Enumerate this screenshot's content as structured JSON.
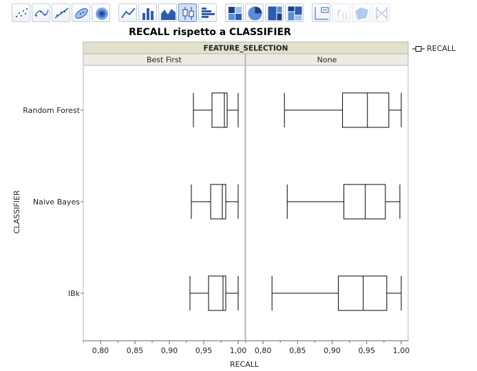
{
  "toolbar": {
    "buttons": [
      {
        "name": "points-icon",
        "state": "normal"
      },
      {
        "name": "smoother-icon",
        "state": "normal"
      },
      {
        "name": "line-of-fit-icon",
        "state": "normal"
      },
      {
        "name": "ellipse-icon",
        "state": "normal"
      },
      {
        "name": "contour-icon",
        "state": "normal"
      },
      {
        "name": "line-chart-icon",
        "state": "normal"
      },
      {
        "name": "bar-chart-icon",
        "state": "normal"
      },
      {
        "name": "area-chart-icon",
        "state": "normal"
      },
      {
        "name": "box-plot-icon",
        "state": "selected"
      },
      {
        "name": "histogram-icon",
        "state": "normal"
      },
      {
        "name": "heatmap-icon",
        "state": "normal"
      },
      {
        "name": "pie-chart-icon",
        "state": "normal"
      },
      {
        "name": "treemap-icon",
        "state": "normal"
      },
      {
        "name": "mosaic-icon",
        "state": "normal"
      },
      {
        "name": "caption-box-icon",
        "state": "normal"
      },
      {
        "name": "formula-icon",
        "state": "disabled"
      },
      {
        "name": "map-shapes-icon",
        "state": "disabled"
      },
      {
        "name": "parallel-plot-icon",
        "state": "disabled"
      }
    ]
  },
  "colors": {
    "header_fill": "#e3e0cc",
    "subheader_fill": "#ecebe4",
    "panel_border": "#b5b5b5",
    "box_stroke": "#000000",
    "box_fill": "#ffffff"
  },
  "chart_data": {
    "type": "boxplot",
    "title": "RECALL rispetto a CLASSIFIER",
    "xlabel": "RECALL",
    "ylabel": "CLASSIFIER",
    "facet_variable": "FEATURE_SELECTION",
    "facets": [
      "Best First",
      "None"
    ],
    "categories": [
      "Random Forest",
      "Naive Bayes",
      "IBk"
    ],
    "xlim": [
      0.775,
      1.01
    ],
    "xticks": [
      0.8,
      0.85,
      0.9,
      0.95,
      1.0
    ],
    "xtick_labels": [
      "0,80",
      "0,85",
      "0,90",
      "0,95",
      "1,00"
    ],
    "grid": false,
    "legend": {
      "position": "top-right",
      "entries": [
        "RECALL"
      ]
    },
    "series": [
      {
        "facet": "Best First",
        "boxes": [
          {
            "category": "Random Forest",
            "min": 0.935,
            "q1": 0.962,
            "median": 0.98,
            "q3": 0.984,
            "max": 1.0
          },
          {
            "category": "Naive Bayes",
            "min": 0.932,
            "q1": 0.96,
            "median": 0.977,
            "q3": 0.982,
            "max": 1.0
          },
          {
            "category": "IBk",
            "min": 0.93,
            "q1": 0.957,
            "median": 0.978,
            "q3": 0.982,
            "max": 1.0
          }
        ]
      },
      {
        "facet": "None",
        "boxes": [
          {
            "category": "Random Forest",
            "min": 0.831,
            "q1": 0.915,
            "median": 0.951,
            "q3": 0.982,
            "max": 1.0
          },
          {
            "category": "Naive Bayes",
            "min": 0.835,
            "q1": 0.917,
            "median": 0.948,
            "q3": 0.977,
            "max": 0.998
          },
          {
            "category": "IBk",
            "min": 0.813,
            "q1": 0.909,
            "median": 0.945,
            "q3": 0.979,
            "max": 1.0
          }
        ]
      }
    ]
  }
}
